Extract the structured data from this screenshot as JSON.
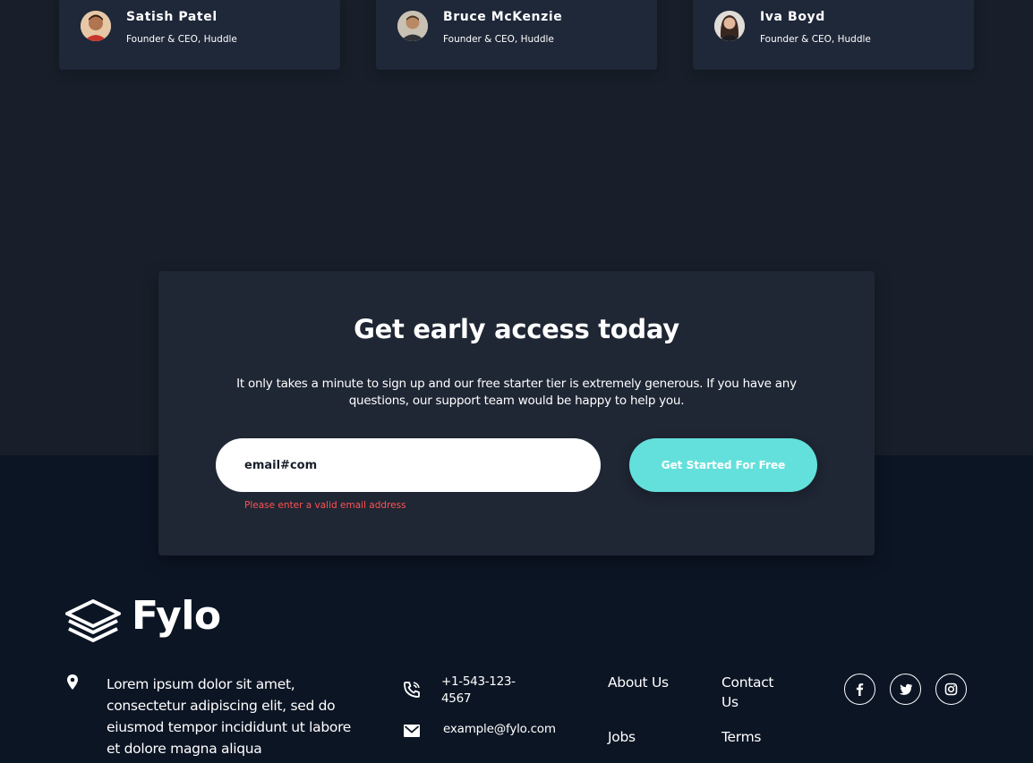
{
  "testimonials": [
    {
      "name": "Satish Patel",
      "role": "Founder & CEO, Huddle",
      "avatar_icon": "avatar-photo"
    },
    {
      "name": "Bruce McKenzie",
      "role": "Founder & CEO, Huddle",
      "avatar_icon": "avatar-photo"
    },
    {
      "name": "Iva Boyd",
      "role": "Founder & CEO, Huddle",
      "avatar_icon": "avatar-photo"
    }
  ],
  "cta": {
    "title": "Get early access today",
    "text": "It only takes a minute to sign up and our free starter tier is extremely generous. If you have any questions, our support team would be happy to help you.",
    "email_value": "email#com",
    "button_label": "Get Started For Free",
    "error": "Please enter a valid email address",
    "button_color": "#63e0db",
    "error_color": "#ff5252"
  },
  "footer": {
    "brand": "Fylo",
    "address": "Lorem ipsum dolor sit amet, consectetur adipiscing elit, sed do eiusmod tempor incididunt ut labore et dolore magna aliqua",
    "phone": "+1-543-123-4567",
    "email": "example@fylo.com",
    "links": {
      "about": "About Us",
      "jobs": "Jobs",
      "contact": "Contact Us",
      "terms": "Terms"
    },
    "social": [
      "facebook-icon",
      "twitter-icon",
      "instagram-icon"
    ]
  },
  "colors": {
    "page_bg": "#181f2a",
    "footer_bg": "#0c1524",
    "card_bg": "#1f2839"
  }
}
